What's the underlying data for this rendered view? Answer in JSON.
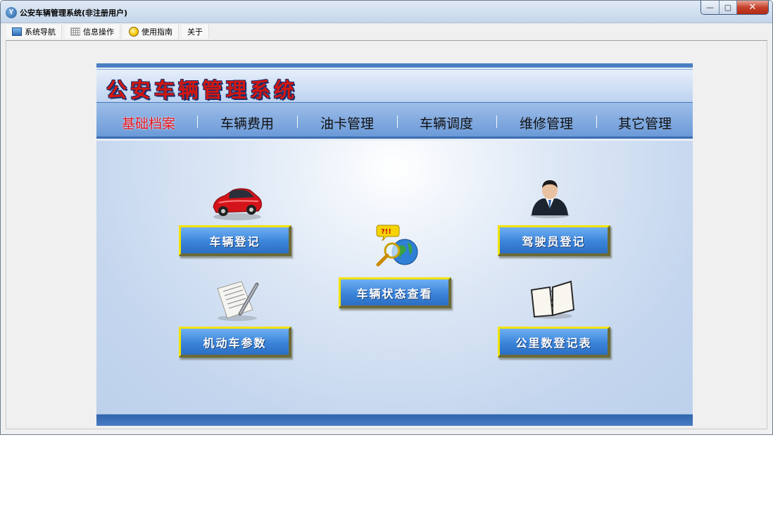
{
  "window": {
    "title": "公安车辆管理系统(非注册用户)",
    "app_icon_letter": "Y",
    "controls": {
      "minimize": "—",
      "maximize": "▢",
      "close": "✕"
    }
  },
  "menubar": {
    "items": [
      {
        "label": "系统导航",
        "icon": "monitor-icon"
      },
      {
        "label": "信息操作",
        "icon": "grid-icon"
      },
      {
        "label": "使用指南",
        "icon": "bulb-icon"
      },
      {
        "label": "关于",
        "icon": ""
      }
    ]
  },
  "panel": {
    "system_title": "公安车辆管理系统",
    "nav": [
      {
        "label": "基础档案",
        "active": true
      },
      {
        "label": "车辆费用",
        "active": false
      },
      {
        "label": "油卡管理",
        "active": false
      },
      {
        "label": "车辆调度",
        "active": false
      },
      {
        "label": "维修管理",
        "active": false
      },
      {
        "label": "其它管理",
        "active": false
      }
    ],
    "buttons": {
      "vehicle_register": "车辆登记",
      "driver_register": "驾驶员登记",
      "vehicle_status": "车辆状态查看",
      "motor_params": "机动车参数",
      "mileage_register": "公里数登记表"
    }
  },
  "colors": {
    "accent_blue": "#3a84da",
    "active_nav": "#e8141b",
    "button_border": "#f2e300"
  }
}
